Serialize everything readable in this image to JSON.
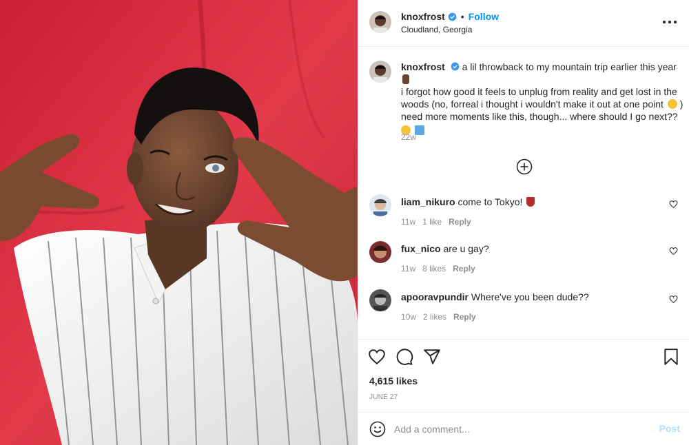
{
  "post": {
    "author": {
      "username": "knoxfrost",
      "verified": true,
      "follow_label": "Follow",
      "separator": "•",
      "location": "Cloudland, Georgia"
    },
    "caption": {
      "username": "knoxfrost",
      "line1": "a lil throwback to my mountain trip earlier this year",
      "line2": "i forgot how good it feels to unplug from reality and get lost in the woods (no, forreal i thought i wouldn't make it out at one point",
      "line3": "need more moments like this, though... where should I go next??",
      "time": "22w"
    },
    "comments": [
      {
        "username": "liam_nikuro",
        "text": "come to Tokyo!",
        "time": "11w",
        "likes": "1 like",
        "reply": "Reply"
      },
      {
        "username": "fux_nico",
        "text": "are u gay?",
        "time": "11w",
        "likes": "8 likes",
        "reply": "Reply"
      },
      {
        "username": "apooravpundir",
        "text": "Where've you been dude??",
        "time": "10w",
        "likes": "2 likes",
        "reply": "Reply"
      }
    ],
    "likes": "4,615 likes",
    "date": "JUNE 27",
    "add_comment_placeholder": "Add a comment...",
    "post_label": "Post"
  },
  "icons": {
    "more": "more-options-icon",
    "load_more": "plus-circle-icon",
    "like": "heart-icon",
    "comment": "comment-icon",
    "share": "share-icon",
    "save": "bookmark-icon",
    "emoji": "smile-icon"
  },
  "colors": {
    "accent": "#0095f6",
    "muted": "#8e8e8e",
    "post_disabled": "#b2dffc",
    "background_photo": "#d42a3b"
  }
}
